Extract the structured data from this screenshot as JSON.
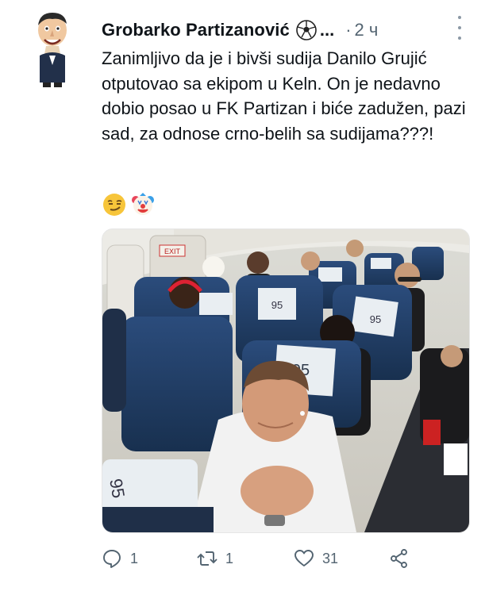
{
  "post": {
    "author_name": "Grobarko Partizanović",
    "name_suffix": "...",
    "separator": "·",
    "time": "2 ч",
    "text": "Zanimljivo da je i bivši sudija Danilo Grujić otputovao sa ekipom u Keln. On je nedavno dobio posao u FK Partizan i biće zadužen, pazi sad, za odnose crno-belih sa sudijama???!",
    "emojis": [
      "smirking-face",
      "clown-face"
    ],
    "media": {
      "description_icon": "airplane-cabin-photo",
      "seat_number": "95"
    }
  },
  "actions": {
    "reply_count": "1",
    "repost_count": "1",
    "like_count": "31"
  },
  "colors": {
    "text": "#0f1419",
    "secondary": "#536471",
    "seat_blue": "#1f3f6e",
    "headrest": "#e9eef2"
  }
}
